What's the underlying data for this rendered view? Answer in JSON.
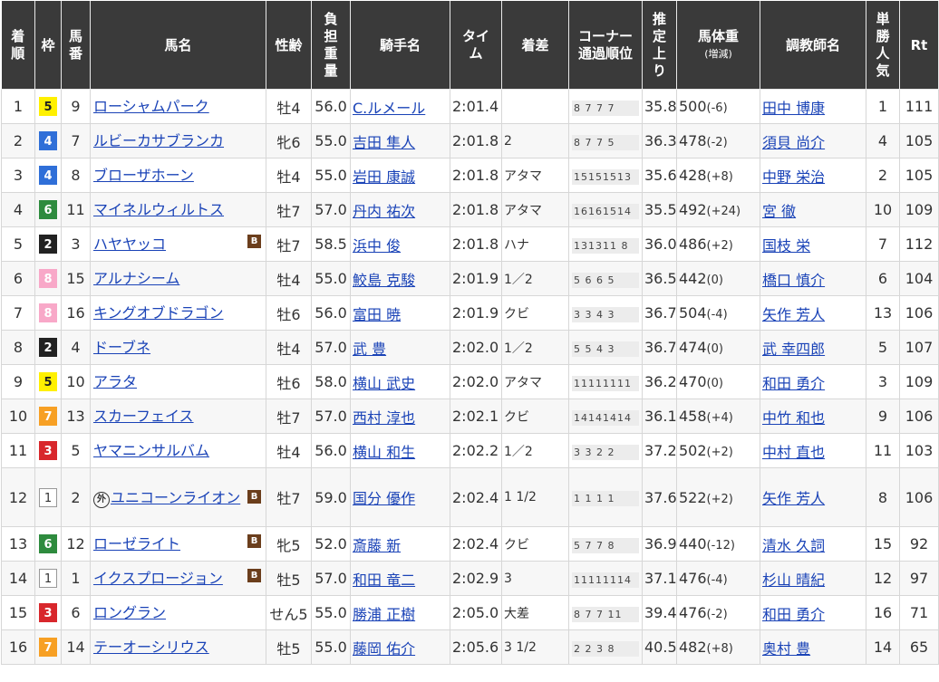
{
  "headers": {
    "rank": "着順",
    "waku": "枠",
    "umaban": "馬番",
    "horse": "馬名",
    "sexage": "性齢",
    "weight": "負担重量",
    "jockey": "騎手名",
    "time": "タイム",
    "margin": "着差",
    "corner": "コーナー通過順位",
    "corner_1": "コーナー",
    "corner_2": "通過順位",
    "last3f": "推定上り",
    "bw": "馬体重",
    "bw_sub": "(増減)",
    "trainer": "調教師名",
    "pop": "単勝人気",
    "rt": "Rt"
  },
  "blinker_label": "B",
  "foreign_label": "外",
  "waku_colors": {
    "1": "#ffffff",
    "2": "#222222",
    "3": "#d8272c",
    "4": "#2f6fd8",
    "5": "#fff000",
    "6": "#2e8b3e",
    "7": "#f7a024",
    "8": "#f8a8c8"
  },
  "rows": [
    {
      "rank": "1",
      "waku": "5",
      "umaban": "9",
      "horse": "ローシャムパーク",
      "b": false,
      "foreign": false,
      "sexage": "牡4",
      "weight": "56.0",
      "jockey": "C.ルメール",
      "time": "2:01.4",
      "margin": "",
      "corner": "8 7 7 7",
      "last3f": "35.8",
      "bw": "500",
      "bw_diff": "(-6)",
      "trainer": "田中 博康",
      "pop": "1",
      "rt": "111"
    },
    {
      "rank": "2",
      "waku": "4",
      "umaban": "7",
      "horse": "ルビーカサブランカ",
      "b": false,
      "foreign": false,
      "sexage": "牝6",
      "weight": "55.0",
      "jockey": "吉田 隼人",
      "time": "2:01.8",
      "margin": "2",
      "corner": "8 7 7 5",
      "last3f": "36.3",
      "bw": "478",
      "bw_diff": "(-2)",
      "trainer": "須貝 尚介",
      "pop": "4",
      "rt": "105"
    },
    {
      "rank": "3",
      "waku": "4",
      "umaban": "8",
      "horse": "ブローザホーン",
      "b": false,
      "foreign": false,
      "sexage": "牡4",
      "weight": "55.0",
      "jockey": "岩田 康誠",
      "time": "2:01.8",
      "margin": "アタマ",
      "corner": "15151513",
      "last3f": "35.6",
      "bw": "428",
      "bw_diff": "(+8)",
      "trainer": "中野 栄治",
      "pop": "2",
      "rt": "105"
    },
    {
      "rank": "4",
      "waku": "6",
      "umaban": "11",
      "horse": "マイネルウィルトス",
      "b": false,
      "foreign": false,
      "sexage": "牡7",
      "weight": "57.0",
      "jockey": "丹内 祐次",
      "time": "2:01.8",
      "margin": "アタマ",
      "corner": "16161514",
      "last3f": "35.5",
      "bw": "492",
      "bw_diff": "(+24)",
      "trainer": "宮 徹",
      "pop": "10",
      "rt": "109"
    },
    {
      "rank": "5",
      "waku": "2",
      "umaban": "3",
      "horse": "ハヤヤッコ",
      "b": true,
      "foreign": false,
      "sexage": "牡7",
      "weight": "58.5",
      "jockey": "浜中 俊",
      "time": "2:01.8",
      "margin": "ハナ",
      "corner": "131311 8",
      "last3f": "36.0",
      "bw": "486",
      "bw_diff": "(+2)",
      "trainer": "国枝 栄",
      "pop": "7",
      "rt": "112"
    },
    {
      "rank": "6",
      "waku": "8",
      "umaban": "15",
      "horse": "アルナシーム",
      "b": false,
      "foreign": false,
      "sexage": "牡4",
      "weight": "55.0",
      "jockey": "鮫島 克駿",
      "time": "2:01.9",
      "margin": "1／2",
      "corner": "5 6 6 5",
      "last3f": "36.5",
      "bw": "442",
      "bw_diff": "(0)",
      "trainer": "橋口 慎介",
      "pop": "6",
      "rt": "104"
    },
    {
      "rank": "7",
      "waku": "8",
      "umaban": "16",
      "horse": "キングオブドラゴン",
      "b": false,
      "foreign": false,
      "sexage": "牡6",
      "weight": "56.0",
      "jockey": "富田 暁",
      "time": "2:01.9",
      "margin": "クビ",
      "corner": "3 3 4 3",
      "last3f": "36.7",
      "bw": "504",
      "bw_diff": "(-4)",
      "trainer": "矢作 芳人",
      "pop": "13",
      "rt": "106"
    },
    {
      "rank": "8",
      "waku": "2",
      "umaban": "4",
      "horse": "ドーブネ",
      "b": false,
      "foreign": false,
      "sexage": "牡4",
      "weight": "57.0",
      "jockey": "武 豊",
      "time": "2:02.0",
      "margin": "1／2",
      "corner": "5 5 4 3",
      "last3f": "36.7",
      "bw": "474",
      "bw_diff": "(0)",
      "trainer": "武 幸四郎",
      "pop": "5",
      "rt": "107"
    },
    {
      "rank": "9",
      "waku": "5",
      "umaban": "10",
      "horse": "アラタ",
      "b": false,
      "foreign": false,
      "sexage": "牡6",
      "weight": "58.0",
      "jockey": "横山 武史",
      "time": "2:02.0",
      "margin": "アタマ",
      "corner": "11111111",
      "last3f": "36.2",
      "bw": "470",
      "bw_diff": "(0)",
      "trainer": "和田 勇介",
      "pop": "3",
      "rt": "109"
    },
    {
      "rank": "10",
      "waku": "7",
      "umaban": "13",
      "horse": "スカーフェイス",
      "b": false,
      "foreign": false,
      "sexage": "牡7",
      "weight": "57.0",
      "jockey": "西村 淳也",
      "time": "2:02.1",
      "margin": "クビ",
      "corner": "14141414",
      "last3f": "36.1",
      "bw": "458",
      "bw_diff": "(+4)",
      "trainer": "中竹 和也",
      "pop": "9",
      "rt": "106"
    },
    {
      "rank": "11",
      "waku": "3",
      "umaban": "5",
      "horse": "ヤマニンサルバム",
      "b": false,
      "foreign": false,
      "sexage": "牡4",
      "weight": "56.0",
      "jockey": "横山 和生",
      "time": "2:02.2",
      "margin": "1／2",
      "corner": "3 3 2 2",
      "last3f": "37.2",
      "bw": "502",
      "bw_diff": "(+2)",
      "trainer": "中村 直也",
      "pop": "11",
      "rt": "103"
    },
    {
      "rank": "12",
      "waku": "1",
      "umaban": "2",
      "horse": "ユニコーンライオン",
      "b": true,
      "foreign": true,
      "sexage": "牡7",
      "weight": "59.0",
      "jockey": "国分 優作",
      "time": "2:02.4",
      "margin": "1 1/2",
      "corner": "1 1 1 1",
      "last3f": "37.6",
      "bw": "522",
      "bw_diff": "(+2)",
      "trainer": "矢作 芳人",
      "pop": "8",
      "rt": "106"
    },
    {
      "rank": "13",
      "waku": "6",
      "umaban": "12",
      "horse": "ローゼライト",
      "b": true,
      "foreign": false,
      "sexage": "牝5",
      "weight": "52.0",
      "jockey": "斎藤 新",
      "time": "2:02.4",
      "margin": "クビ",
      "corner": "5 7 7 8",
      "last3f": "36.9",
      "bw": "440",
      "bw_diff": "(-12)",
      "trainer": "清水 久詞",
      "pop": "15",
      "rt": "92"
    },
    {
      "rank": "14",
      "waku": "1",
      "umaban": "1",
      "horse": "イクスプロージョン",
      "b": true,
      "foreign": false,
      "sexage": "牡5",
      "weight": "57.0",
      "jockey": "和田 竜二",
      "time": "2:02.9",
      "margin": "3",
      "corner": "11111114",
      "last3f": "37.1",
      "bw": "476",
      "bw_diff": "(-4)",
      "trainer": "杉山 晴紀",
      "pop": "12",
      "rt": "97"
    },
    {
      "rank": "15",
      "waku": "3",
      "umaban": "6",
      "horse": "ロングラン",
      "b": false,
      "foreign": false,
      "sexage": "せん5",
      "weight": "55.0",
      "jockey": "勝浦 正樹",
      "time": "2:05.0",
      "margin": "大差",
      "corner": "8 7 7 11",
      "last3f": "39.4",
      "bw": "476",
      "bw_diff": "(-2)",
      "trainer": "和田 勇介",
      "pop": "16",
      "rt": "71"
    },
    {
      "rank": "16",
      "waku": "7",
      "umaban": "14",
      "horse": "テーオーシリウス",
      "b": false,
      "foreign": false,
      "sexage": "牡5",
      "weight": "55.0",
      "jockey": "藤岡 佑介",
      "time": "2:05.6",
      "margin": "3 1/2",
      "corner": "2 2 3 8",
      "last3f": "40.5",
      "bw": "482",
      "bw_diff": "(+8)",
      "trainer": "奥村 豊",
      "pop": "14",
      "rt": "65"
    }
  ]
}
